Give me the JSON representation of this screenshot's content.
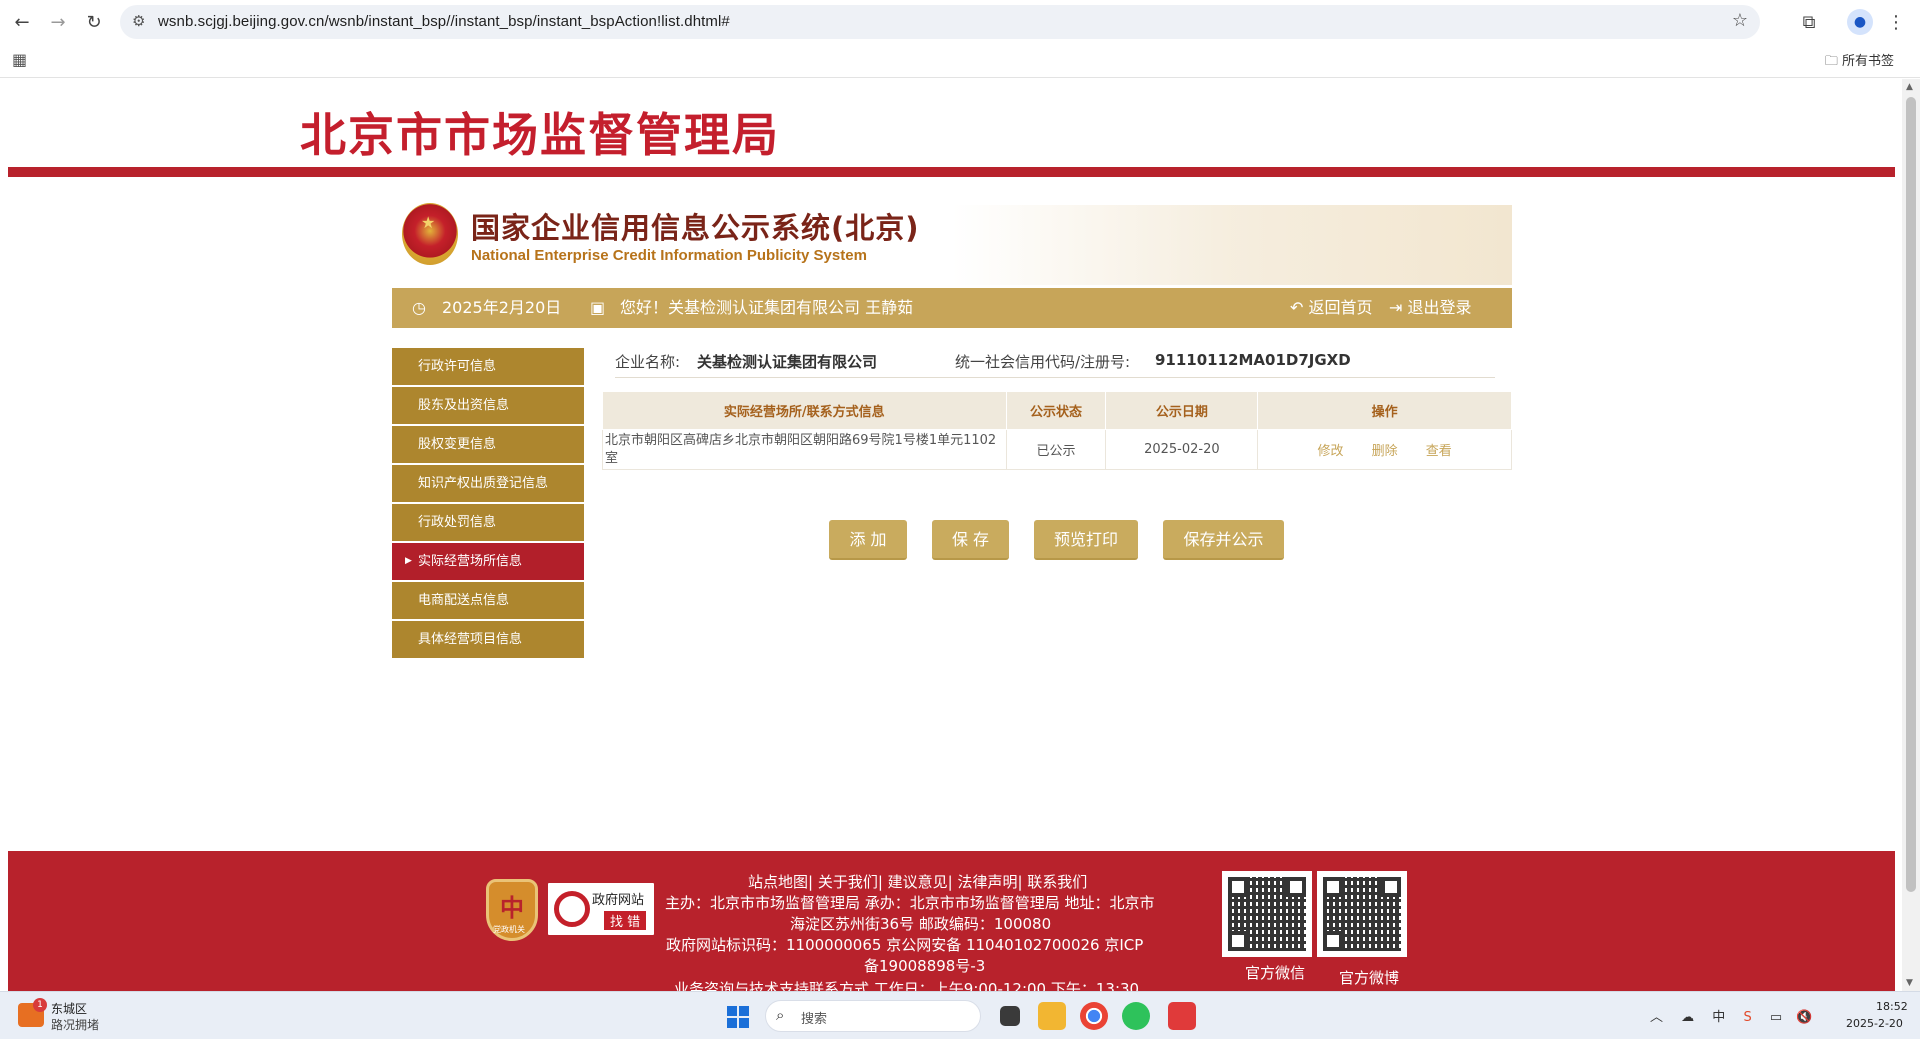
{
  "browser": {
    "url": "wsnb.scjgj.beijing.gov.cn/wsnb/instant_bsp//instant_bsp/instant_bspAction!list.dhtml#",
    "bookmarks_all": "所有书签"
  },
  "header": {
    "bureau_title": "北京市市场监督管理局",
    "system_title": "国家企业信用信息公示系统(北京)",
    "system_subtitle": "National Enterprise Credit Information Publicity System",
    "date": "2025年2月20日",
    "greeting": "您好！关基检测认证集团有限公司  王静茹",
    "home_label": "返回首页",
    "logout_label": "退出登录"
  },
  "side_menu": {
    "items": [
      {
        "label": "行政许可信息"
      },
      {
        "label": "股东及出资信息"
      },
      {
        "label": "股权变更信息"
      },
      {
        "label": "知识产权出质登记信息"
      },
      {
        "label": "行政处罚信息"
      },
      {
        "label": "实际经营场所信息",
        "active": true
      },
      {
        "label": "电商配送点信息"
      },
      {
        "label": "具体经营项目信息"
      }
    ]
  },
  "company": {
    "name_label": "企业名称:",
    "name_value": "关基检测认证集团有限公司",
    "code_label": "统一社会信用代码/注册号:",
    "code_value": "91110112MA01D7JGXD"
  },
  "table": {
    "headers": [
      "实际经营场所/联系方式信息",
      "公示状态",
      "公示日期",
      "操作"
    ],
    "rows": [
      {
        "address": "北京市朝阳区高碑店乡北京市朝阳区朝阳路69号院1号楼1单元1102室",
        "status": "已公示",
        "date": "2025-02-20",
        "ops": [
          "修改",
          "删除",
          "查看"
        ]
      }
    ]
  },
  "actions": {
    "add": "添 加",
    "save": "保 存",
    "preview": "预览打印",
    "save_publish": "保存并公示"
  },
  "footer": {
    "links": "站点地图| 关于我们| 建议意见| 法律声明| 联系我们",
    "host": "主办：北京市市场监督管理局 承办：北京市市场监督管理局 地址：北京市",
    "address2": "海淀区苏州街36号 邮政编码：100080",
    "site_code": "政府网站标识码：1100000065    京公网安备 11040102700026    京ICP",
    "icp2": "备19008898号-3",
    "support": "业务咨询与技术支持联系方式    工作日：上午9:00-12:00 下午：13:30",
    "party_badge_text": "党政机关",
    "gov_error_line1": "政府网站",
    "gov_error_line2": "找 错",
    "qr1_label": "官方微信",
    "qr2_label": "官方微博"
  },
  "taskbar": {
    "weather_badge": "1",
    "weather_city": "东城区",
    "weather_status": "路况拥堵",
    "search_placeholder": "搜索",
    "tray_ime": "中",
    "time": "18:52",
    "date": "2025-2-20"
  }
}
